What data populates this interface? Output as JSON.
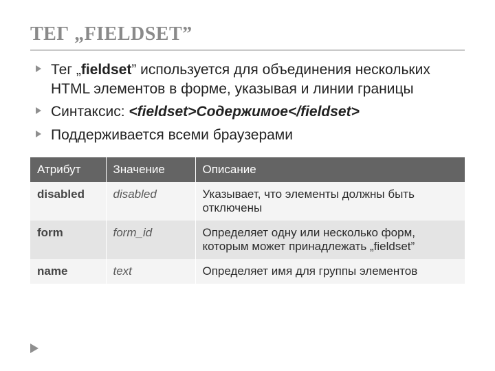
{
  "title": "ТЕГ „FIELDSET”",
  "bullets": {
    "b1_pre": "Тег „",
    "b1_bold": "fieldset",
    "b1_post": "” используется для объединения нескольких HTML элементов в форме, указывая и линии границы",
    "b2_label": "Синтаксис: ",
    "b2_code": "<fieldset>Содержимое</fieldset>",
    "b3": "Поддерживается всеми браузерами"
  },
  "table": {
    "headers": {
      "attr": "Атрибут",
      "value": "Значение",
      "desc": "Описание"
    },
    "rows": [
      {
        "attr": "disabled",
        "value": "disabled",
        "desc": "Указывает, что элементы должны быть отключены"
      },
      {
        "attr": "form",
        "value": "form_id",
        "desc": "Определяет одну или несколько форм, которым может принадлежать „fieldset”"
      },
      {
        "attr": "name",
        "value": "text",
        "desc": "Определяет имя для группы элементов"
      }
    ]
  }
}
